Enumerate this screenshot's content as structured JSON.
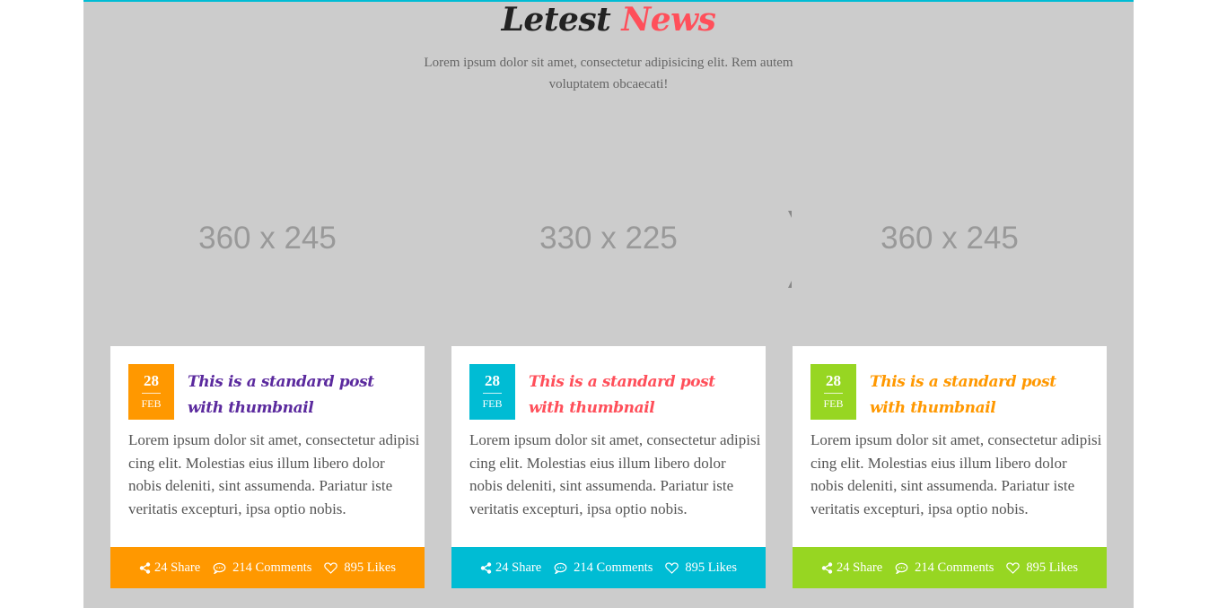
{
  "section": {
    "heading_word1": "Letest",
    "heading_word2": "News",
    "subtitle": "Lorem ipsum dolor sit amet, consectetur adipisicing elit. Rem autem voluptatem obcaecati!"
  },
  "colors": {
    "accent_top_border": "#00bcd4",
    "heading_highlight": "#ff4f5a",
    "section_bg": "#cccccc"
  },
  "posts": [
    {
      "thumbnail_label": "360 x 245",
      "date_day": "28",
      "date_month": "FEB",
      "title": "This is a standard post with thumbnail",
      "excerpt": "Lorem ipsum dolor sit amet, consectetur adipisi cing elit. Molestias eius illum libero dolor nobis deleniti, sint assumenda. Pariatur iste veritatis excepturi, ipsa optio nobis.",
      "share": "24 Share",
      "comments": "214 Comments",
      "likes": "895 Likes",
      "accent_color": "#ff9800",
      "title_color": "#5b2a9e"
    },
    {
      "thumbnail_label": "330 x 225",
      "date_day": "28",
      "date_month": "FEB",
      "title": "This is a standard post with thumbnail",
      "excerpt": "Lorem ipsum dolor sit amet, consectetur adipisi cing elit. Molestias eius illum libero dolor nobis deleniti, sint assumenda. Pariatur iste veritatis excepturi, ipsa optio nobis.",
      "share": "24 Share",
      "comments": "214 Comments",
      "likes": "895 Likes",
      "accent_color": "#00bcd4",
      "title_color": "#ff4f5a"
    },
    {
      "thumbnail_label": "360 x 245",
      "date_day": "28",
      "date_month": "FEB",
      "title": "This is a standard post with thumbnail",
      "excerpt": "Lorem ipsum dolor sit amet, consectetur adipisi cing elit. Molestias eius illum libero dolor nobis deleniti, sint assumenda. Pariatur iste veritatis excepturi, ipsa optio nobis.",
      "share": "24 Share",
      "comments": "214 Comments",
      "likes": "895 Likes",
      "accent_color": "#97d622",
      "title_color": "#ff9800"
    }
  ],
  "icons": {
    "share": "share-icon",
    "comments": "comment-icon",
    "likes": "heart-icon"
  }
}
